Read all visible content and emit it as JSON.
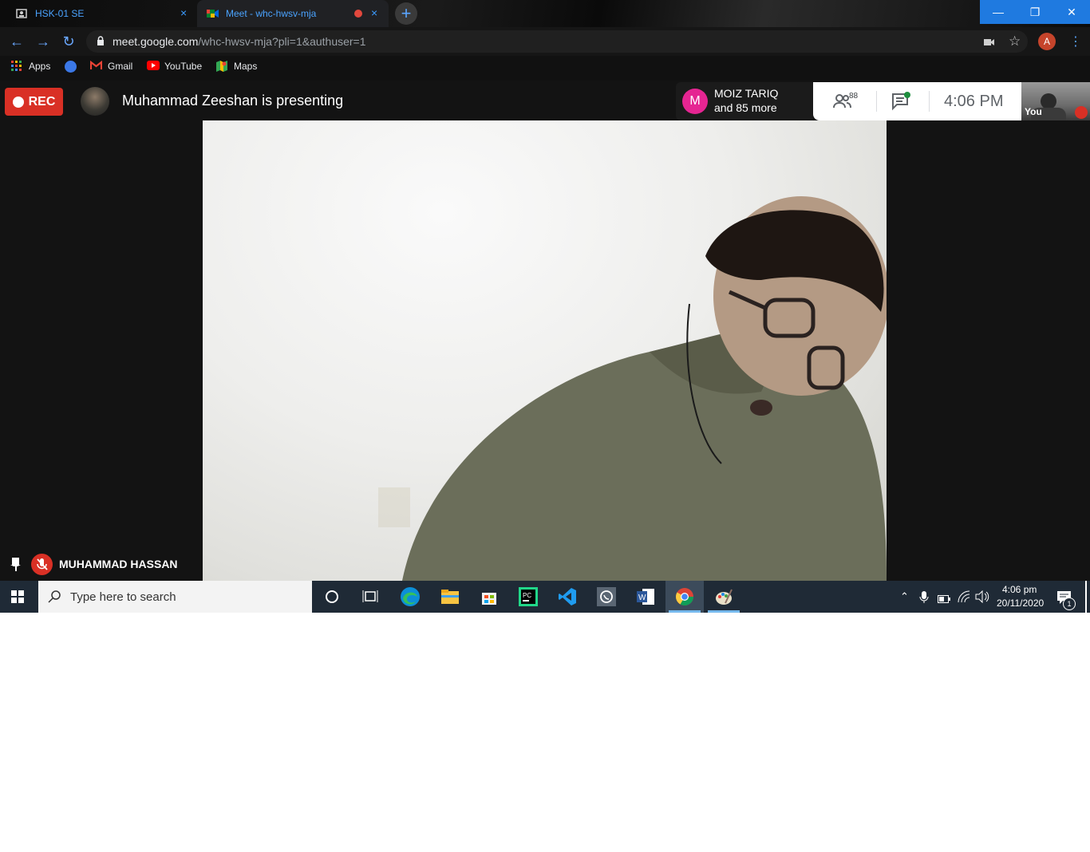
{
  "browser": {
    "tabs": [
      {
        "title": "HSK-01 SE",
        "close": "×"
      },
      {
        "title": "Meet - whc-hwsv-mja",
        "close": "×"
      }
    ],
    "new_tab": "+",
    "window_controls": {
      "minimize": "—",
      "restore": "❐",
      "close": "✕"
    },
    "url_host": "meet.google.com",
    "url_path": "/whc-hwsv-mja?pli=1&authuser=1",
    "profile_initial": "A",
    "bookmarks": [
      "Apps",
      "Gmail",
      "YouTube",
      "Maps"
    ]
  },
  "meet": {
    "rec_label": "REC",
    "presenting_text": "Muhammad Zeeshan is presenting",
    "participant_initial": "M",
    "participant_name": "MOIZ TARIQ",
    "participant_more": "and 85 more",
    "people_count": "88",
    "clock": "4:06  PM",
    "self_label": "You",
    "speaker_name": "MUHAMMAD HASSAN"
  },
  "taskbar": {
    "search_placeholder": "Type here to search",
    "time": "4:06 pm",
    "date": "20/11/2020",
    "notification_count": "1"
  },
  "colors": {
    "rec_red": "#d93025",
    "accent_blue": "#1f7ae0",
    "moiz_pink": "#e52592",
    "taskbar": "#1f2a36"
  }
}
